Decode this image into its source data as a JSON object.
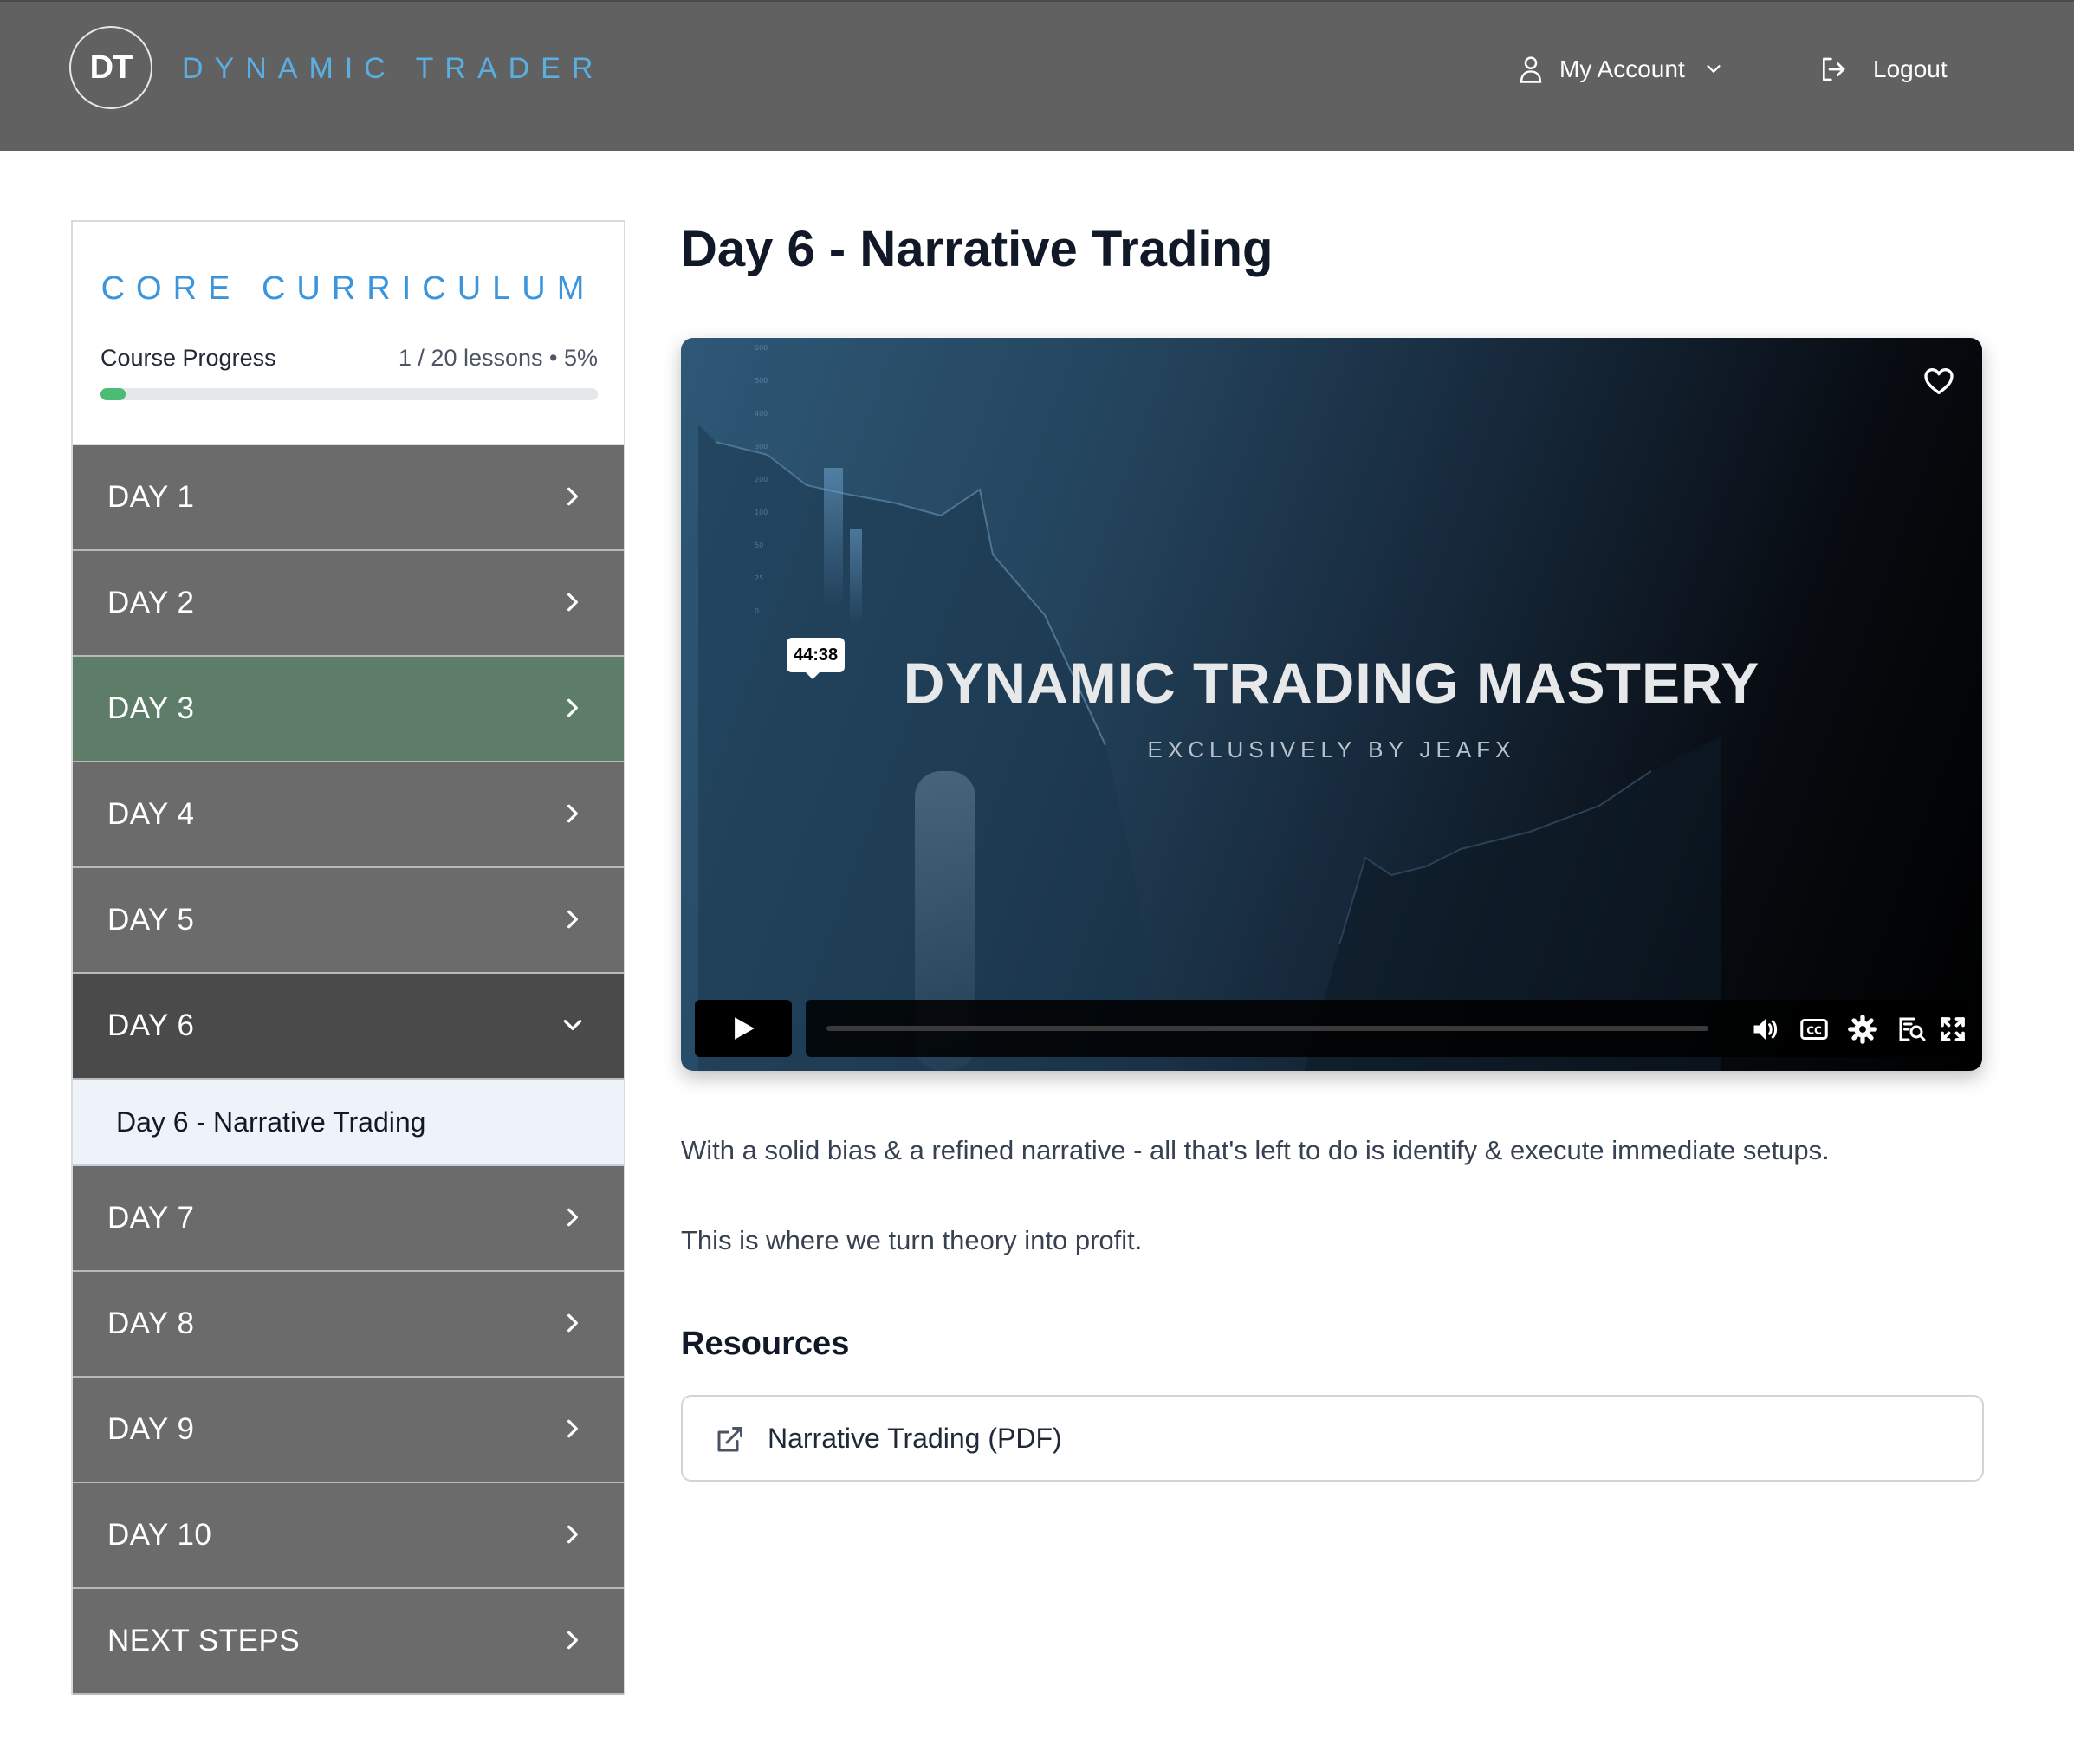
{
  "header": {
    "logo_initials": "DT",
    "brand_name": "DYNAMIC TRADER",
    "account_label": "My Account",
    "logout_label": "Logout"
  },
  "sidebar": {
    "title": "CORE CURRICULUM",
    "progress_label": "Course Progress",
    "progress_stats": "1 / 20 lessons • 5%",
    "progress_fraction": 0.05,
    "days": [
      {
        "label": "DAY 1",
        "state": "default"
      },
      {
        "label": "DAY 2",
        "state": "default"
      },
      {
        "label": "DAY 3",
        "state": "completed"
      },
      {
        "label": "DAY 4",
        "state": "default"
      },
      {
        "label": "DAY 5",
        "state": "default"
      },
      {
        "label": "DAY 6",
        "state": "expanded"
      },
      {
        "label": "DAY 7",
        "state": "default"
      },
      {
        "label": "DAY 8",
        "state": "default"
      },
      {
        "label": "DAY 9",
        "state": "default"
      },
      {
        "label": "DAY 10",
        "state": "default"
      },
      {
        "label": "NEXT STEPS",
        "state": "default"
      }
    ],
    "active_lesson": "Day 6 - Narrative Trading"
  },
  "main": {
    "title": "Day 6 - Narrative Trading",
    "video": {
      "title": "DYNAMIC TRADING MASTERY",
      "subtitle": "EXCLUSIVELY BY JEAFX",
      "duration": "44:38",
      "progress_fraction": 0
    },
    "description": [
      "With a solid bias & a refined narrative - all that's left to do is identify & execute immediate setups.",
      "This is where we turn theory into profit."
    ],
    "resources_title": "Resources",
    "resources": [
      {
        "label": "Narrative Trading (PDF)",
        "icon": "external-link-icon"
      }
    ]
  },
  "colors": {
    "header_bg": "#616161",
    "brand": "#5aaee0",
    "day_default": "#6b6b6b",
    "day_completed": "#5d7d69",
    "day_active": "#4a4a4a",
    "progress_fill": "#4cbb74"
  }
}
